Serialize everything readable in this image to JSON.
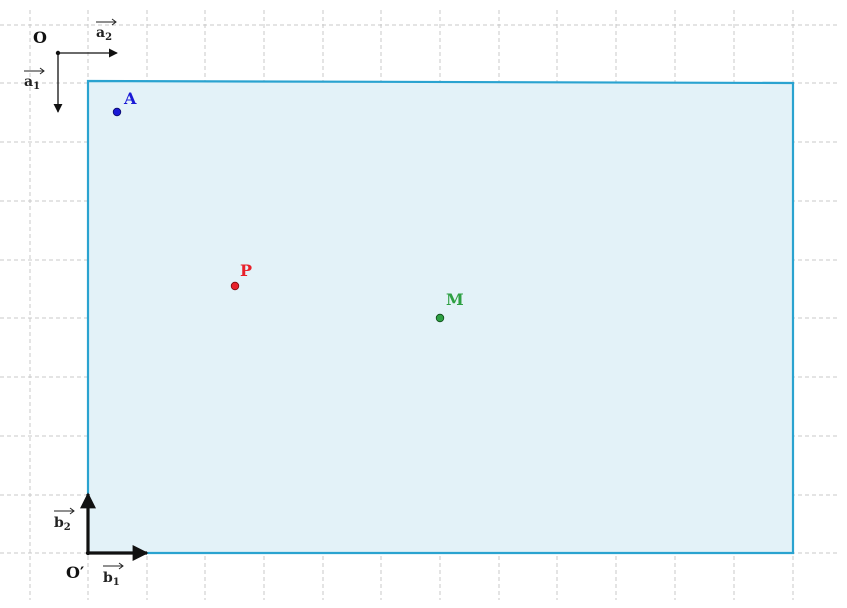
{
  "figure": {
    "origin_top_label": "O",
    "origin_bottom_label": "O′",
    "vectors": {
      "a1": {
        "letter": "a",
        "sub": "1"
      },
      "a2": {
        "letter": "a",
        "sub": "2"
      },
      "b1": {
        "letter": "b",
        "sub": "1"
      },
      "b2": {
        "letter": "b",
        "sub": "2"
      }
    },
    "points": [
      {
        "label": "A",
        "color": "#1a1ad6"
      },
      {
        "label": "P",
        "color": "#e8202a"
      },
      {
        "label": "M",
        "color": "#2ea043"
      }
    ],
    "colors": {
      "rect_fill": "#e3f2f8",
      "rect_stroke": "#2aa3d0",
      "grid": "#c8c8c8",
      "axis": "#111111"
    }
  }
}
